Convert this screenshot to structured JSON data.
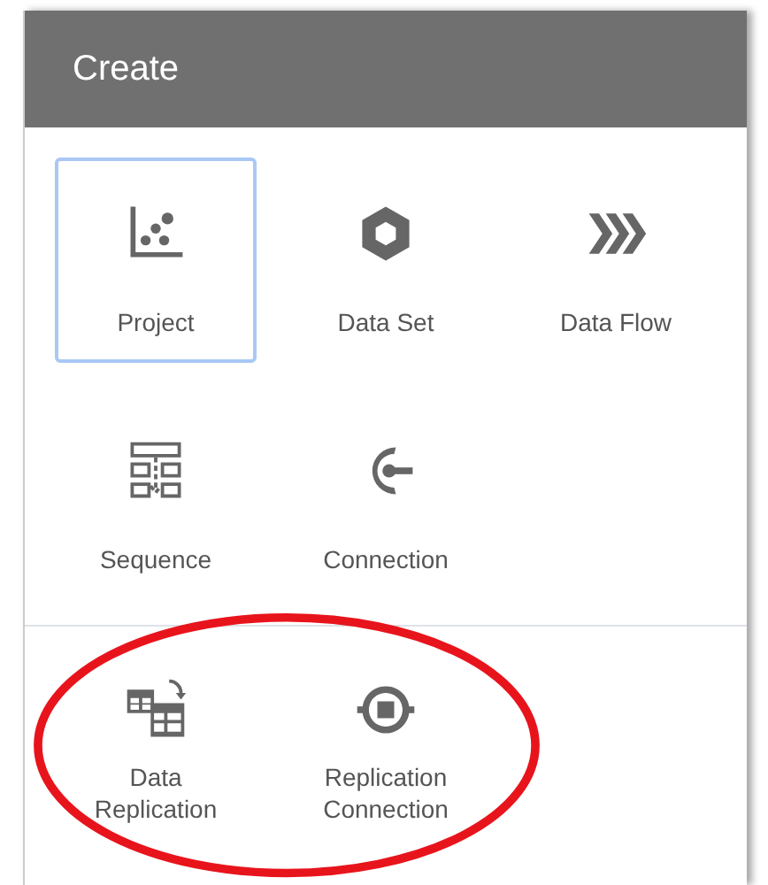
{
  "panel": {
    "title": "Create"
  },
  "sections": [
    {
      "items": [
        {
          "label": "Project",
          "selected": true
        },
        {
          "label": "Data Set",
          "selected": false
        },
        {
          "label": "Data Flow",
          "selected": false
        },
        {
          "label": "Sequence",
          "selected": false
        },
        {
          "label": "Connection",
          "selected": false
        }
      ]
    },
    {
      "items": [
        {
          "label": "Data Replication",
          "selected": false
        },
        {
          "label": "Replication Connection",
          "selected": false
        }
      ]
    }
  ]
}
